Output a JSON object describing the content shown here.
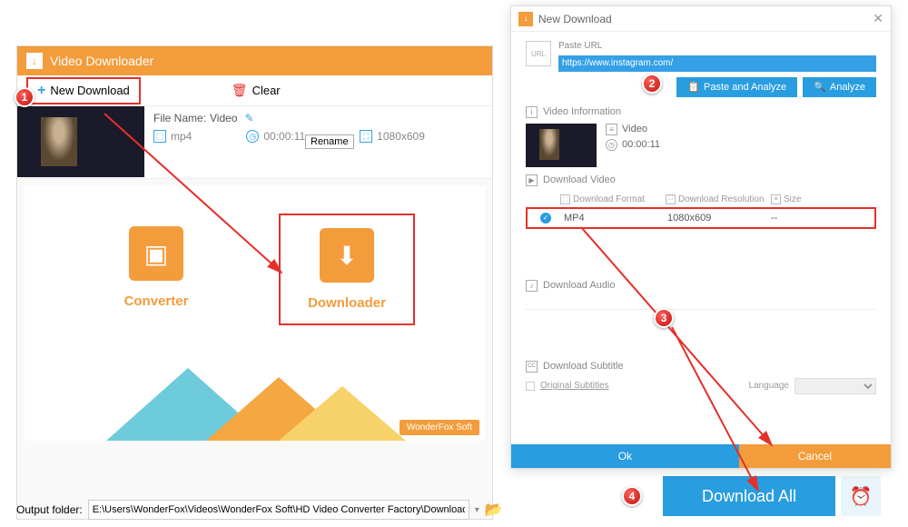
{
  "main": {
    "title": "Video Downloader",
    "new_download": "New Download",
    "clear": "Clear",
    "file_name_label": "File Name:",
    "file_name_value": "Video",
    "rename_tip": "Rename",
    "format": "mp4",
    "duration": "00:00:11",
    "resolution": "1080x609",
    "converter": "Converter",
    "downloader": "Downloader",
    "wonderfox": "WonderFox Soft",
    "output_label": "Output folder:",
    "output_path": "E:\\Users\\WonderFox\\Videos\\WonderFox Soft\\HD Video Converter Factory\\Download_Video\\"
  },
  "dialog": {
    "title": "New Download",
    "paste_url_label": "Paste URL",
    "url_value": "https://www.instagram.com/",
    "paste_analyze": "Paste and Analyze",
    "analyze": "Analyze",
    "video_info": "Video Information",
    "vname": "Video",
    "vduration": "00:00:11",
    "download_video": "Download Video",
    "col_format": "Download Format",
    "col_res": "Download Resolution",
    "col_size": "Size",
    "row_format": "MP4",
    "row_res": "1080x609",
    "row_size": "--",
    "download_audio": "Download Audio",
    "download_subtitle": "Download Subtitle",
    "orig_subs": "Original Subtitles",
    "language": "Language",
    "ok": "Ok",
    "cancel": "Cancel"
  },
  "download_all": "Download All",
  "steps": {
    "s1": "1",
    "s2": "2",
    "s3": "3",
    "s4": "4"
  }
}
